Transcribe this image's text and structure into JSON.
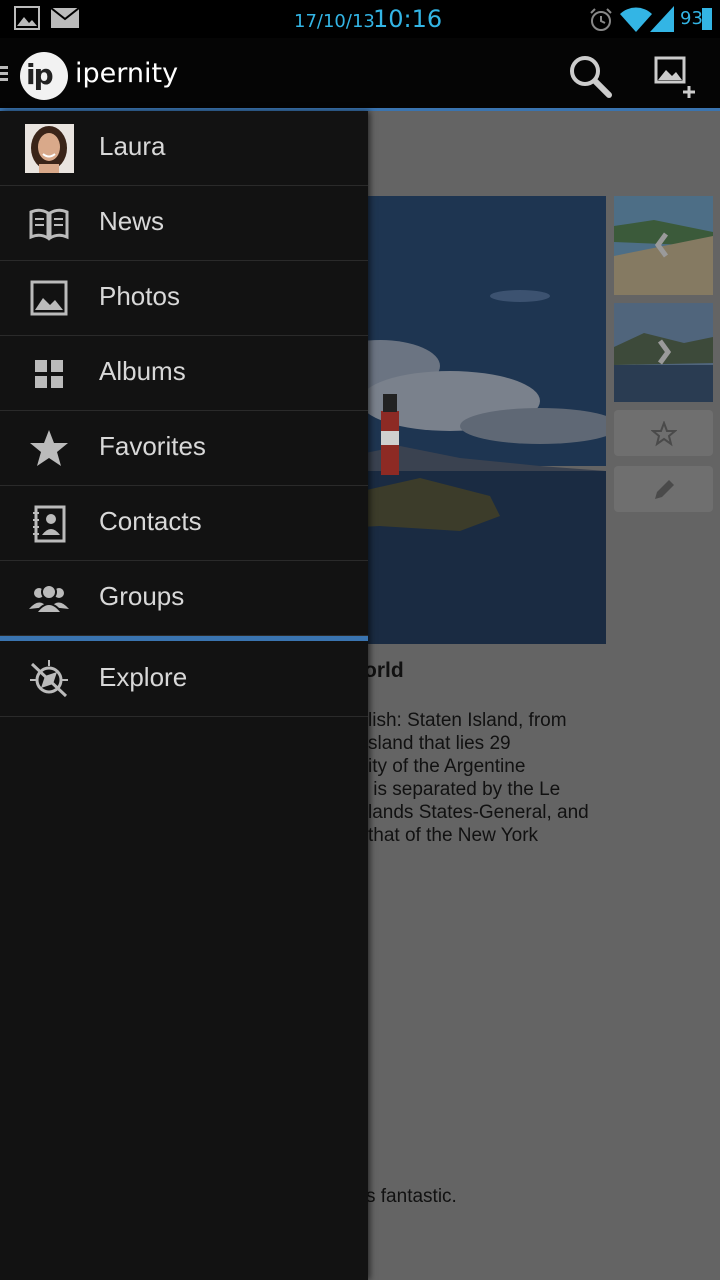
{
  "status_bar": {
    "date": "17/10/13",
    "time": "10:16",
    "battery": "93"
  },
  "action_bar": {
    "app_name": "ipernity",
    "logo_text": "ip"
  },
  "drawer": {
    "user_name": "Laura",
    "items": [
      {
        "label": "News",
        "icon": "news-icon"
      },
      {
        "label": "Photos",
        "icon": "photo-icon"
      },
      {
        "label": "Albums",
        "icon": "albums-icon"
      },
      {
        "label": "Favorites",
        "icon": "star-icon"
      },
      {
        "label": "Contacts",
        "icon": "contacts-icon"
      },
      {
        "label": "Groups",
        "icon": "groups-icon"
      }
    ],
    "explore_label": "Explore"
  },
  "content": {
    "title_fragment": "orld",
    "description_fragment": "lish: Staten Island, from\nsland that lies 29\nity of the Argentine\n is separated by the Le\nlands States-General, and\nthat of the New York",
    "comment_fragment": "s fantastic."
  },
  "colors": {
    "accent": "#33b5e5",
    "divider": "#3a74b0",
    "drawer_bg": "#121212"
  }
}
